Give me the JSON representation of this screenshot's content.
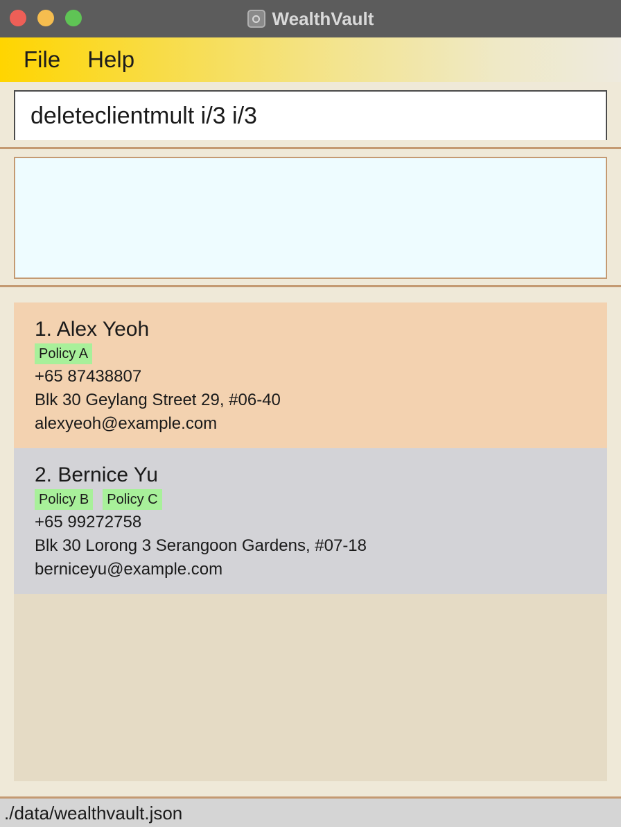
{
  "window": {
    "title": "WealthVault"
  },
  "menu": {
    "file": "File",
    "help": "Help"
  },
  "command": {
    "value": "deleteclientmult i/3 i/3"
  },
  "result": {
    "text": ""
  },
  "clients": [
    {
      "index_name": "1. Alex Yeoh",
      "tags": [
        "Policy A"
      ],
      "phone": "+65 87438807",
      "address": "Blk 30 Geylang Street 29, #06-40",
      "email": "alexyeoh@example.com"
    },
    {
      "index_name": "2. Bernice Yu",
      "tags": [
        "Policy B",
        "Policy C"
      ],
      "phone": "+65 99272758",
      "address": "Blk 30 Lorong 3 Serangoon Gardens, #07-18",
      "email": "berniceyu@example.com"
    }
  ],
  "status": {
    "path": "./data/wealthvault.json"
  },
  "colors": {
    "accent": "#ffd500",
    "card_selected": "#f3d2b0",
    "card_default": "#d3d3d7",
    "tag": "#a8f09a",
    "result_bg": "#eefcff"
  }
}
